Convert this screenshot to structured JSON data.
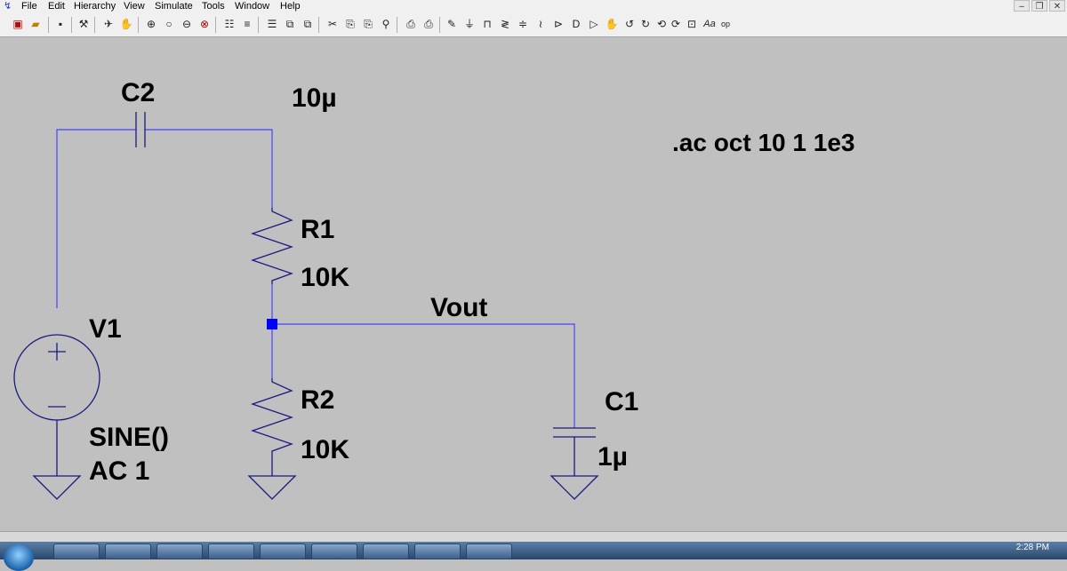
{
  "menubar": {
    "items": [
      "File",
      "Edit",
      "Hierarchy",
      "View",
      "Simulate",
      "Tools",
      "Window",
      "Help"
    ]
  },
  "toolbar": {
    "icons": [
      "new-schematic-icon",
      "open-icon",
      "save-icon",
      "control-panel-icon",
      "run-icon",
      "pan-hand-icon",
      "zoom-in-icon",
      "zoom-pan-icon",
      "zoom-out-icon",
      "zoom-fit-icon",
      "autorange-icon",
      "tile-horizontal-icon",
      "tile-vertical-icon",
      "cascade-icon",
      "cut-icon",
      "copy-icon",
      "find-icon",
      "print-preview-icon",
      "print-icon",
      "wire-icon",
      "ground-icon",
      "label-net-icon",
      "resistor-icon",
      "capacitor-icon",
      "inductor-icon",
      "diode-icon",
      "component-icon",
      "rotate-icon",
      "mirror-icon",
      "undo-icon",
      "redo-icon",
      "drag-icon",
      "move-icon",
      "text-icon",
      "spice-directive-icon"
    ]
  },
  "schematic": {
    "c2": {
      "name": "C2",
      "value": "10µ"
    },
    "r1": {
      "name": "R1",
      "value": "10K"
    },
    "r2": {
      "name": "R2",
      "value": "10K"
    },
    "c1": {
      "name": "C1",
      "value": "1µ"
    },
    "v1": {
      "name": "V1",
      "value_line1": "SINE()",
      "value_line2": "AC 1"
    },
    "net_label": "Vout",
    "directive": ".ac oct 10 1 1e3"
  },
  "taskbar": {
    "clock": "2:28 PM"
  },
  "colors": {
    "wire": "#4444ff",
    "component": "#1a1a80",
    "junction": "#0000ff",
    "background": "#c0c0c0"
  }
}
